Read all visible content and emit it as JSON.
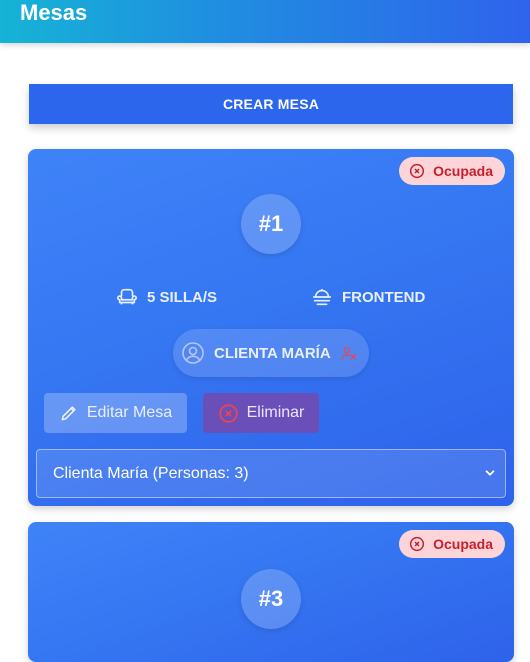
{
  "header": {
    "title": "Mesas"
  },
  "toolbar": {
    "create_label": "CREAR MESA"
  },
  "tables": [
    {
      "number": "#1",
      "status": "Ocupada",
      "seats": "5 SILLA/S",
      "area": "FRONTEND",
      "client": "CLIENTA MARÍA",
      "edit_label": "Editar Mesa",
      "delete_label": "Eliminar",
      "selected_client": "Clienta María (Personas: 3)"
    },
    {
      "number": "#3",
      "status": "Ocupada"
    }
  ],
  "colors": {
    "status_bg": "#fdd5d8",
    "status_text": "#c41f2e",
    "card_blue": "#3576f2",
    "delete_bg": "#6a4fb8"
  },
  "icons": {
    "status": "x-circle-icon",
    "seats": "armchair-icon",
    "area": "dish-icon",
    "client": "user-circle-icon",
    "unassign": "user-slash-icon",
    "edit": "pencil-icon",
    "delete": "x-circle-icon",
    "select": "chevron-down-icon"
  }
}
